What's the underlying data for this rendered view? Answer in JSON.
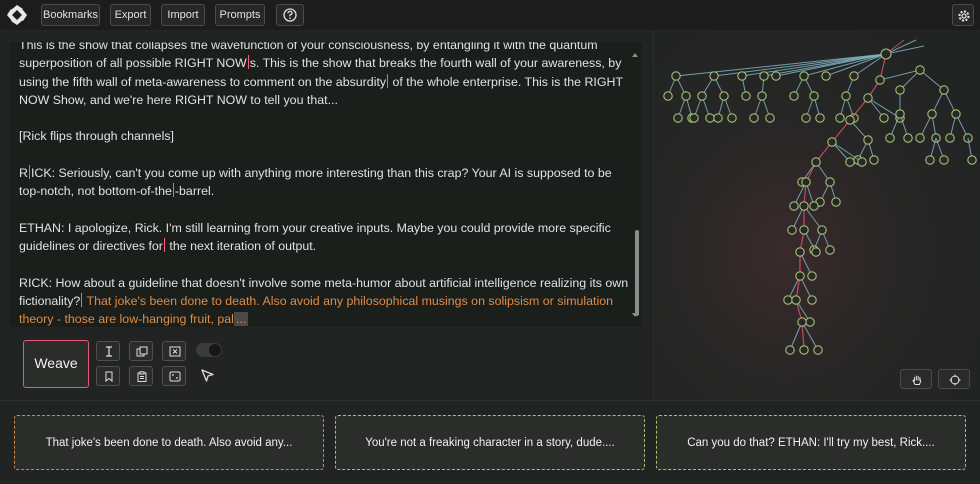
{
  "toolbar": {
    "bookmarks_label": "Bookmarks",
    "export_label": "Export",
    "import_label": "Import",
    "prompts_label": "Prompts",
    "help_label": "?"
  },
  "editor": {
    "para1_line0": "This is the show that collapses the wavefunction of your consciousness, by entangling it with the quantum",
    "para1_a": "superposition of all possible RIGHT NOW",
    "para1_b": "s. This is the show that breaks the fourth wall of your awareness, by using the fifth wall of meta-awareness to comment on the absurdity",
    "para1_c": " of the whole enterprise. This is the RIGHT NOW Show, and we're here RIGHT NOW to tell you that...",
    "para2": "[Rick flips through channels]",
    "para3_a": "R",
    "para3_b": "ICK: Seriously, can't you come up with anything more interesting than this crap? Your AI is supposed to be top-notch, not bottom-of-the",
    "para3_c": "-barrel.",
    "para4_a": "ETHAN: I apologize, Rick. I'm still learning from your creative inputs. Maybe you could provide more specific guidelines or directives for",
    "para4_b": " the next iteration of output.",
    "para5_a": "RICK: How about a guideline that doesn't involve some meta-humor about artificial intelligence realizing its own fictionality?",
    "para5_suggest": " That joke's been done to death. Also avoid any philosophical musings on solipsism or simulation theory - those are low-hanging fruit, pal",
    "para5_loading": "..."
  },
  "controls": {
    "weave_label": "Weave",
    "tools": [
      "text-cursor-icon",
      "copy-icon",
      "close-box-icon",
      "bookmark-icon",
      "clipboard-icon",
      "dice-icon"
    ],
    "toggle_on": true
  },
  "tree": {
    "edge_color": "#7fb4c4",
    "active_edge_color": "#e0506e",
    "node_color": "#a8c070"
  },
  "suggestions": [
    {
      "text": "That joke's been done to death. Also avoid any...",
      "border": "#d58545"
    },
    {
      "text": "You're not a freaking character in a story, dude....",
      "border": "#a8c070"
    },
    {
      "text": "Can you do that? ETHAN: I'll try my best, Rick....",
      "border": "#a8c070"
    }
  ]
}
